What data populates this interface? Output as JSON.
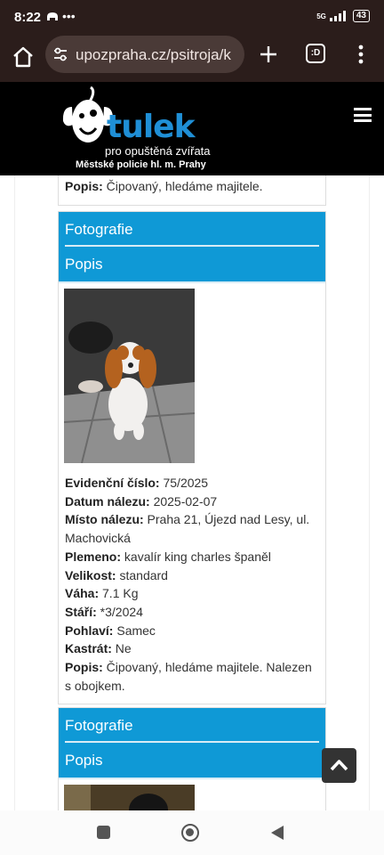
{
  "status": {
    "time": "8:22",
    "network": "5G",
    "battery": "43"
  },
  "browser": {
    "url": "upozpraha.cz/psitroja/k",
    "tab_label": ":D"
  },
  "site": {
    "logo_word": "tulek",
    "logo_sub1": "pro opuštěná zvířata",
    "logo_sub2": "Městské policie hl. m. Prahy"
  },
  "labels": {
    "fotografie": "Fotografie",
    "popis": "Popis"
  },
  "prev_card": {
    "popis_label": "Popis:",
    "popis_value": " Čipovaný, hledáme majitele."
  },
  "card1": {
    "fields": [
      {
        "label": "Evidenční číslo:",
        "value": " 75/2025"
      },
      {
        "label": "Datum nálezu:",
        "value": " 2025-02-07"
      },
      {
        "label": "Místo nálezu:",
        "value": " Praha 21, Újezd nad Lesy, ul. Machovická"
      },
      {
        "label": "Plemeno:",
        "value": " kavalír king charles španěl"
      },
      {
        "label": "Velikost:",
        "value": " standard"
      },
      {
        "label": "Váha:",
        "value": " 7.1 Kg"
      },
      {
        "label": "Stáří:",
        "value": " *3/2024"
      },
      {
        "label": "Pohlaví:",
        "value": " Samec"
      },
      {
        "label": "Kastrát:",
        "value": " Ne"
      },
      {
        "label": "Popis:",
        "value": " Čipovaný, hledáme majitele. Nalezen s obojkem."
      }
    ]
  },
  "colors": {
    "header_blue": "#0f99d6",
    "chrome": "#2b1d1b",
    "site_header": "#000000"
  },
  "icons": [
    "home-icon",
    "tune-icon",
    "plus-icon",
    "tabs-icon",
    "more-vert-icon",
    "hamburger-icon",
    "chevron-up-icon",
    "recents-icon",
    "home-nav-icon",
    "back-icon"
  ]
}
